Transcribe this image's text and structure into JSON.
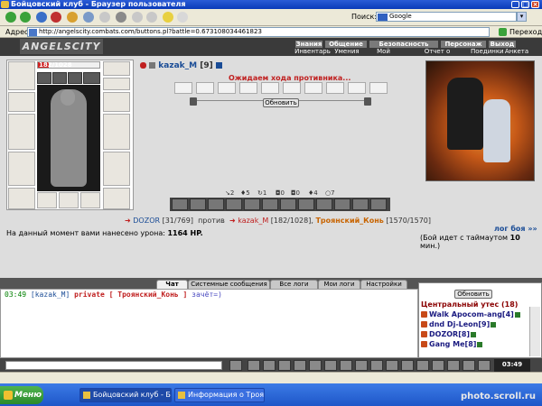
{
  "window": {
    "title": "Бойцовский клуб - Браузер пользователя"
  },
  "toolbar": {
    "search_label": "Поиск:",
    "search_value": "Google"
  },
  "address": {
    "label": "Адрес:",
    "url": "http://angelscity.combats.com/buttons.pl?battle=0.673108034461823",
    "go": "Переход"
  },
  "game": {
    "logo": "ANGELSCITY",
    "menu_top": [
      "Знания",
      "Общение",
      "Безопасность",
      "Персонаж",
      "Выход"
    ],
    "menu_bottom": [
      "Инвентарь",
      "Умения",
      "Мой Скроллл",
      "Отчет о переводах",
      "Поединки",
      "Анкета"
    ]
  },
  "player": {
    "nick": "kazak_M",
    "level": "[9]",
    "hp": "182/1028",
    "hp_fraction": 0.18
  },
  "battle": {
    "waiting": "Ожидаем хода противника...",
    "refresh": "Обновить",
    "stats": [
      "2",
      "5",
      "1",
      "0",
      "0",
      "4",
      "7"
    ],
    "enemy1": "DOZOR",
    "enemy1_hp": "[31/769]",
    "versus": "против",
    "me": "kazak_M",
    "me_hp": "[182/1028]",
    "enemy2": "Троянский_Конь",
    "enemy2_hp": "[1570/1570]",
    "damage_text": "На данный момент вами нанесено урона:",
    "damage_value": "1164 HP.",
    "log_link": "лог боя »»",
    "timeout_pre": "(Бой идет с таймаутом",
    "timeout_num": "10",
    "timeout_post": "мин.)"
  },
  "tabs": [
    "Чат",
    "Системные сообщения",
    "Все логи",
    "Мои логи",
    "Настройки"
  ],
  "chat": {
    "time": "03:49",
    "user": "[kazak_M]",
    "private": "private [ Троянский_Конь ]",
    "text": "зачёт=)"
  },
  "room": {
    "refresh": "Обновить",
    "title": "Центральный утес (18)",
    "users": [
      "Walk Apocom-ang[4]",
      "dnd Dj-Leon[9]",
      "DOZOR[8]",
      "Gang Me[8]"
    ]
  },
  "clock": "03:49",
  "taskbar": {
    "start": "Меню",
    "items": [
      "Бойцовский клуб - Бр...",
      "Информация о Троянс..."
    ]
  },
  "watermark": "photo.scroll.ru"
}
